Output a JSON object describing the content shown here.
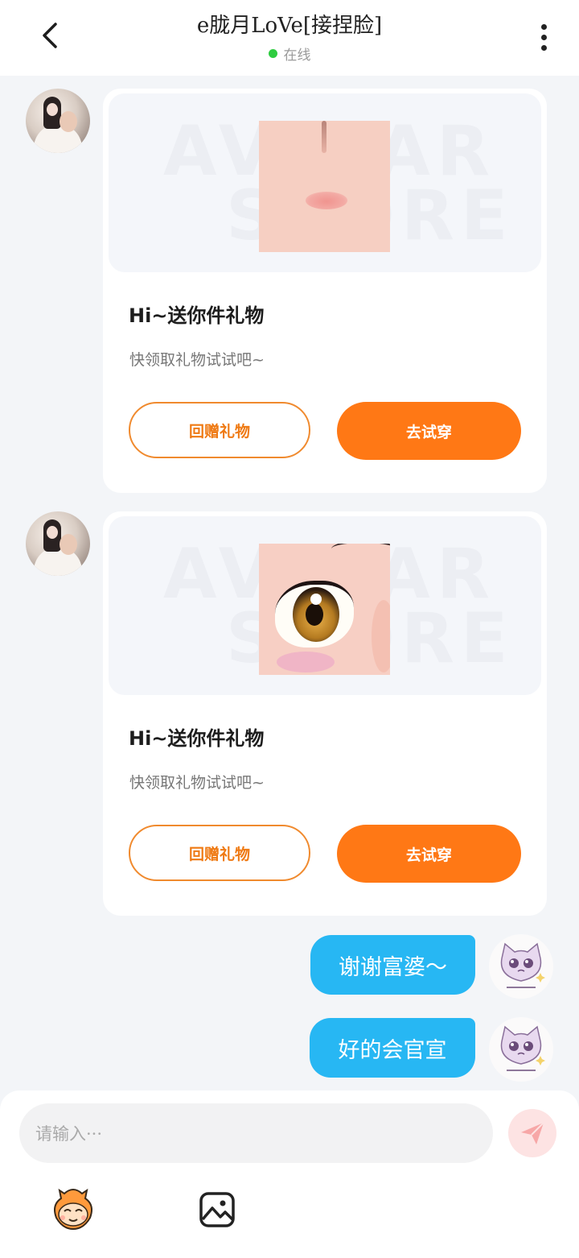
{
  "header": {
    "title": "e胧月LoVe[接捏脸]",
    "status": "在线"
  },
  "messages": [
    {
      "type": "gift",
      "side": "left",
      "watermark_line1": "AVATAR",
      "watermark_line2": "STORE",
      "title": "Hi~送你件礼物",
      "subtitle": "快领取礼物试试吧~",
      "btn_return": "回赠礼物",
      "btn_try": "去试穿"
    },
    {
      "type": "gift",
      "side": "left",
      "watermark_line1": "AVATAR",
      "watermark_line2": "STORE",
      "title": "Hi~送你件礼物",
      "subtitle": "快领取礼物试试吧~",
      "btn_return": "回赠礼物",
      "btn_try": "去试穿"
    },
    {
      "type": "text",
      "side": "right",
      "text": "谢谢富婆～"
    },
    {
      "type": "text",
      "side": "right",
      "text": "好的会官宣"
    }
  ],
  "composer": {
    "placeholder": "请输入···",
    "icons": [
      "emoji-icon",
      "image-icon",
      "send-icon"
    ]
  },
  "colors": {
    "accent_orange": "#ff7815",
    "bubble_blue": "#27b7f3",
    "online_green": "#2ecc40"
  }
}
